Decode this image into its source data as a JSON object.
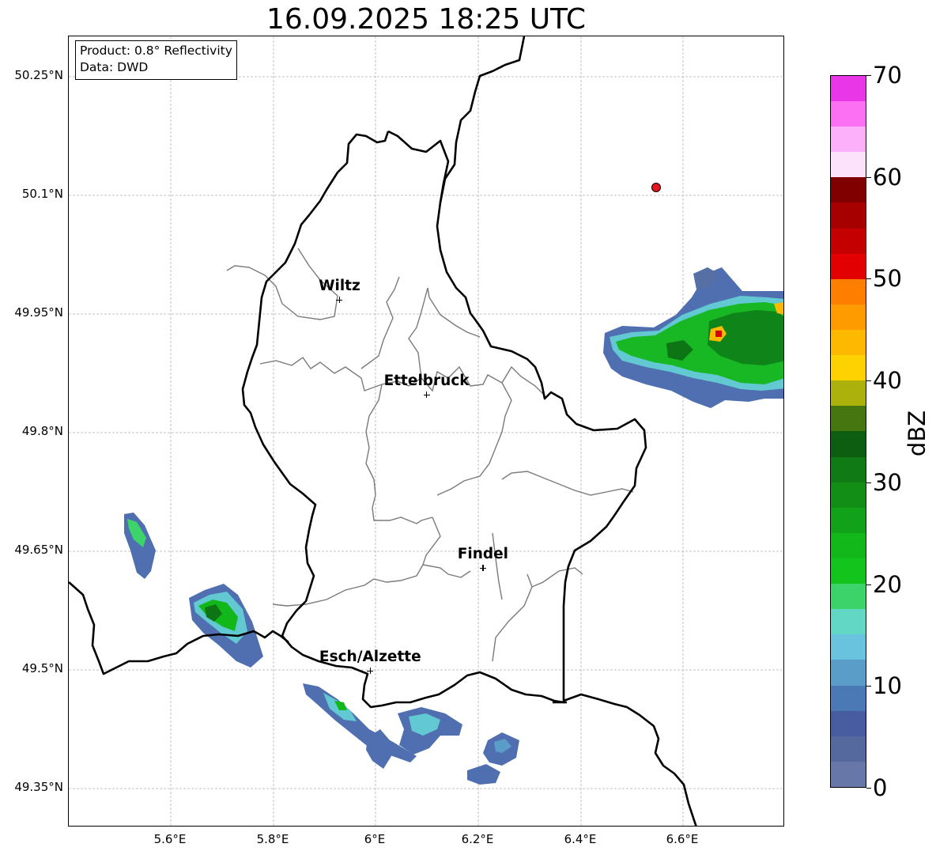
{
  "title": "16.09.2025 18:25 UTC",
  "info": {
    "product": "Product: 0.8° Reflectivity",
    "source": "Data: DWD"
  },
  "axes": {
    "lon_ticks": [
      "5.6°E",
      "5.8°E",
      "6°E",
      "6.2°E",
      "6.4°E",
      "6.6°E"
    ],
    "lat_ticks": [
      "50.25°N",
      "50.1°N",
      "49.95°N",
      "49.8°N",
      "49.65°N",
      "49.5°N",
      "49.35°N"
    ]
  },
  "cities": [
    {
      "name": "Wiltz",
      "lon": 5.93,
      "lat": 49.966
    },
    {
      "name": "Ettelbruck",
      "lon": 6.1,
      "lat": 49.846
    },
    {
      "name": "Findel",
      "lon": 6.21,
      "lat": 49.627
    },
    {
      "name": "Esch/Alzette",
      "lon": 5.99,
      "lat": 49.497
    }
  ],
  "radar_site": {
    "lon": 6.548,
    "lat": 50.11,
    "color": "#e8141c"
  },
  "colorbar": {
    "unit": "dBZ",
    "labels": [
      "0",
      "10",
      "20",
      "30",
      "40",
      "50",
      "60",
      "70"
    ],
    "colors": [
      "#6677a8",
      "#56699f",
      "#485ca0",
      "#4a79b5",
      "#5b9dc9",
      "#69c2de",
      "#62d8c4",
      "#3dd36b",
      "#12c41b",
      "#12b81a",
      "#12a219",
      "#128d16",
      "#107a14",
      "#0d5e11",
      "#457610",
      "#adb10c",
      "#fed200",
      "#fdb900",
      "#fe9b00",
      "#fe7f00",
      "#e30000",
      "#c40000",
      "#a60000",
      "#800000",
      "#fce3fc",
      "#fdb0fa",
      "#fc70f4",
      "#e937e7"
    ]
  }
}
